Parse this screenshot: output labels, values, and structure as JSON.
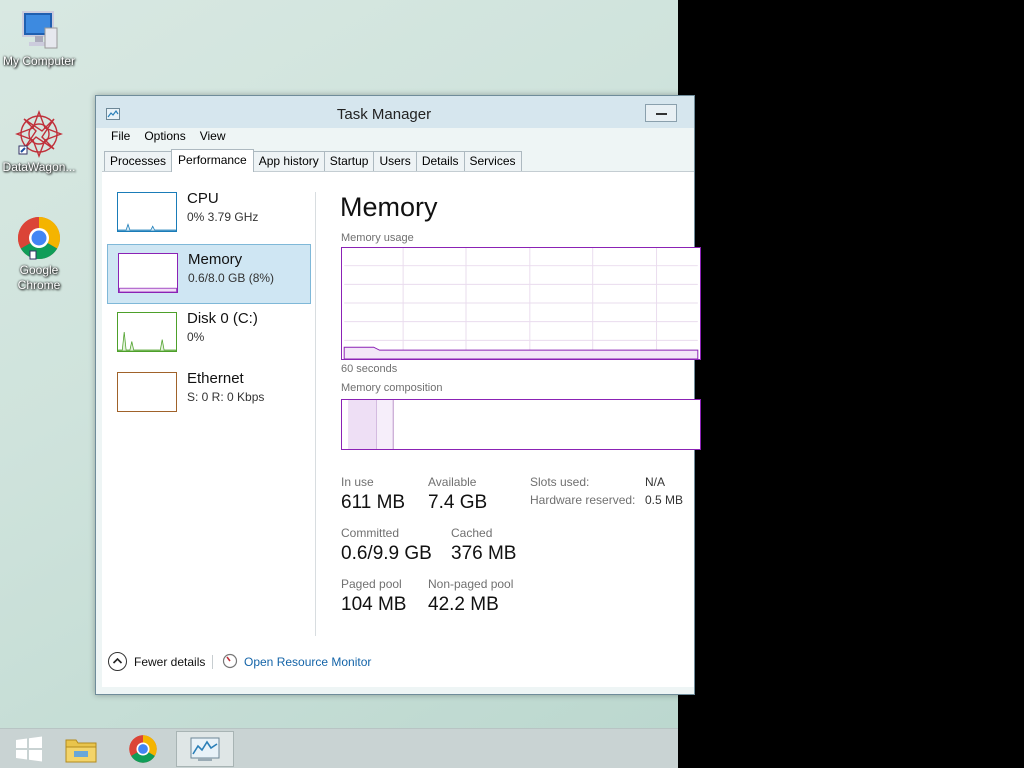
{
  "desktop": {
    "icons": [
      {
        "label": "My Computer"
      },
      {
        "label": "DataWagon..."
      },
      {
        "label": "Google Chrome"
      }
    ]
  },
  "window": {
    "title": "Task Manager",
    "menu": [
      "File",
      "Options",
      "View"
    ],
    "tabs": [
      "Processes",
      "Performance",
      "App history",
      "Startup",
      "Users",
      "Details",
      "Services"
    ],
    "active_tab": "Performance"
  },
  "sidebar": {
    "items": [
      {
        "name": "CPU",
        "sub": "0%  3.79 GHz",
        "color": "#1a7cb8"
      },
      {
        "name": "Memory",
        "sub": "0.6/8.0 GB (8%)",
        "color": "#8b22b5"
      },
      {
        "name": "Disk 0 (C:)",
        "sub": "0%",
        "color": "#4da02a"
      },
      {
        "name": "Ethernet",
        "sub": "S: 0  R: 0 Kbps",
        "color": "#a0622a"
      }
    ]
  },
  "memory": {
    "title": "Memory",
    "usage_label": "Memory usage",
    "time_label": "60 seconds",
    "composition_label": "Memory composition",
    "in_use_label": "In use",
    "in_use": "611 MB",
    "available_label": "Available",
    "available": "7.4 GB",
    "committed_label": "Committed",
    "committed": "0.6/9.9 GB",
    "cached_label": "Cached",
    "cached": "376 MB",
    "paged_label": "Paged pool",
    "paged": "104 MB",
    "nonpaged_label": "Non-paged pool",
    "nonpaged": "42.2 MB",
    "slots_label": "Slots used:",
    "slots": "N/A",
    "hw_label": "Hardware reserved:",
    "hw": "0.5 MB",
    "accent": "#8b22b5"
  },
  "footer": {
    "fewer": "Fewer details",
    "resource_monitor": "Open Resource Monitor"
  }
}
